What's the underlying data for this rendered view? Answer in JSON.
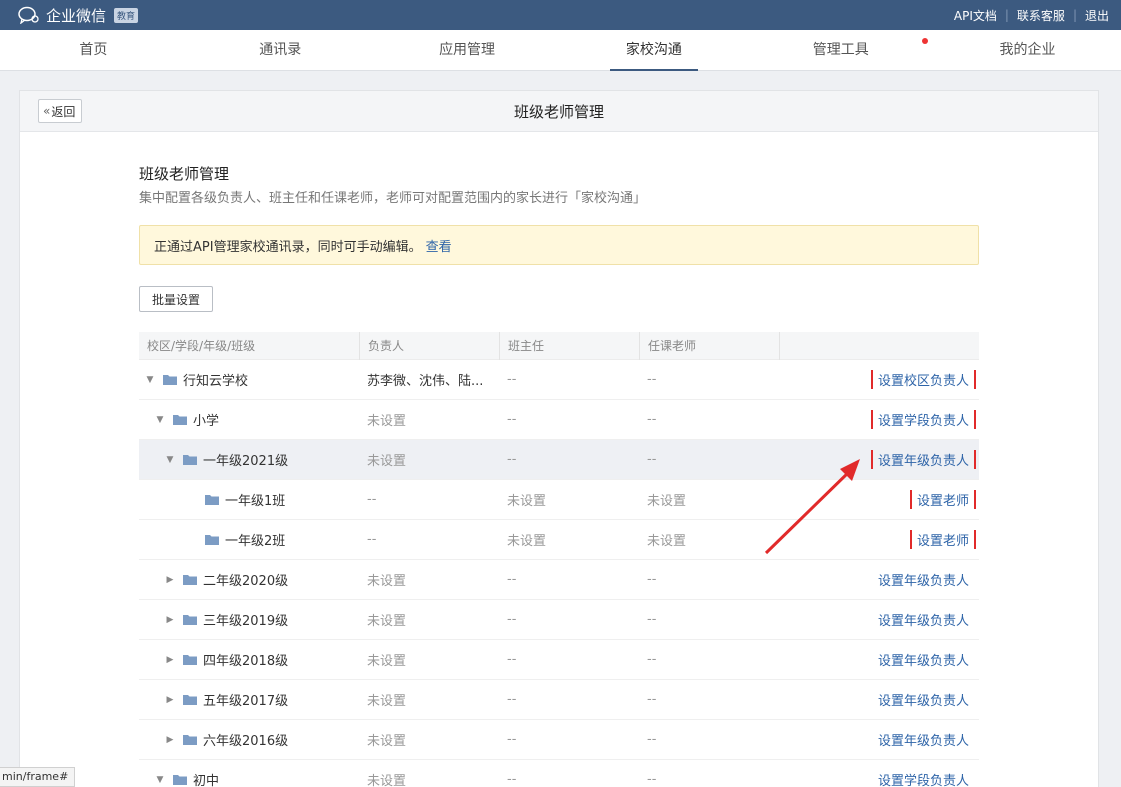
{
  "app": {
    "brand": "企业微信",
    "badge": "教育",
    "top_links": [
      "API文档",
      "联系客服",
      "退出"
    ]
  },
  "nav": [
    {
      "label": "首页",
      "active": false,
      "dot": false
    },
    {
      "label": "通讯录",
      "active": false,
      "dot": false
    },
    {
      "label": "应用管理",
      "active": false,
      "dot": false
    },
    {
      "label": "家校沟通",
      "active": true,
      "dot": false
    },
    {
      "label": "管理工具",
      "active": false,
      "dot": true
    },
    {
      "label": "我的企业",
      "active": false,
      "dot": false
    }
  ],
  "panel": {
    "back_label": "返回",
    "title": "班级老师管理"
  },
  "section": {
    "title": "班级老师管理",
    "desc": "集中配置各级负责人、班主任和任课老师，老师可对配置范围内的家长进行「家校沟通」"
  },
  "notice": {
    "text": "正通过API管理家校通讯录，同时可手动编辑。",
    "link": "查看"
  },
  "bulk_button": "批量设置",
  "table": {
    "headers": [
      "校区/学段/年级/班级",
      "负责人",
      "班主任",
      "任课老师"
    ],
    "rows": [
      {
        "indent": 0,
        "expand": "open",
        "name": "行知云学校",
        "owner": "苏李微、沈伟、陆...",
        "head": "--",
        "teachers": "--",
        "action": "设置校区负责人",
        "highlight": false,
        "boxed": true
      },
      {
        "indent": 1,
        "expand": "open",
        "name": "小学",
        "owner": "未设置",
        "head": "--",
        "teachers": "--",
        "action": "设置学段负责人",
        "highlight": false,
        "boxed": true
      },
      {
        "indent": 2,
        "expand": "open",
        "name": "一年级2021级",
        "owner": "未设置",
        "head": "--",
        "teachers": "--",
        "action": "设置年级负责人",
        "highlight": true,
        "boxed": true
      },
      {
        "indent": 3,
        "expand": "none",
        "name": "一年级1班",
        "owner": "--",
        "head": "未设置",
        "teachers": "未设置",
        "action": "设置老师",
        "highlight": false,
        "boxed": true
      },
      {
        "indent": 3,
        "expand": "none",
        "name": "一年级2班",
        "owner": "--",
        "head": "未设置",
        "teachers": "未设置",
        "action": "设置老师",
        "highlight": false,
        "boxed": true
      },
      {
        "indent": 2,
        "expand": "closed",
        "name": "二年级2020级",
        "owner": "未设置",
        "head": "--",
        "teachers": "--",
        "action": "设置年级负责人",
        "highlight": false,
        "boxed": false
      },
      {
        "indent": 2,
        "expand": "closed",
        "name": "三年级2019级",
        "owner": "未设置",
        "head": "--",
        "teachers": "--",
        "action": "设置年级负责人",
        "highlight": false,
        "boxed": false
      },
      {
        "indent": 2,
        "expand": "closed",
        "name": "四年级2018级",
        "owner": "未设置",
        "head": "--",
        "teachers": "--",
        "action": "设置年级负责人",
        "highlight": false,
        "boxed": false
      },
      {
        "indent": 2,
        "expand": "closed",
        "name": "五年级2017级",
        "owner": "未设置",
        "head": "--",
        "teachers": "--",
        "action": "设置年级负责人",
        "highlight": false,
        "boxed": false
      },
      {
        "indent": 2,
        "expand": "closed",
        "name": "六年级2016级",
        "owner": "未设置",
        "head": "--",
        "teachers": "--",
        "action": "设置年级负责人",
        "highlight": false,
        "boxed": false
      },
      {
        "indent": 1,
        "expand": "open",
        "name": "初中",
        "owner": "未设置",
        "head": "--",
        "teachers": "--",
        "action": "设置学段负责人",
        "highlight": false,
        "boxed": false
      }
    ]
  },
  "status_url": "min/frame#",
  "colors": {
    "accent": "#3c5a80",
    "link": "#2e64a8",
    "annotation": "#e12a2a"
  }
}
